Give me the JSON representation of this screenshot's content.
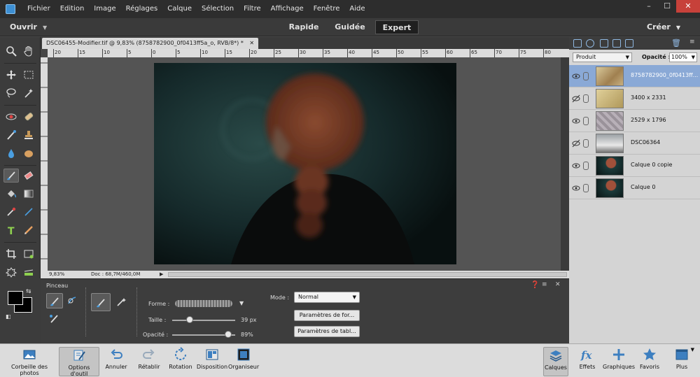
{
  "menubar": {
    "items": [
      "Fichier",
      "Edition",
      "Image",
      "Réglages",
      "Calque",
      "Sélection",
      "Filtre",
      "Affichage",
      "Fenêtre",
      "Aide"
    ],
    "window_controls": [
      "–",
      "☐",
      "✕"
    ]
  },
  "modebar": {
    "open_label": "Ouvrir",
    "tabs": [
      {
        "label": "Rapide"
      },
      {
        "label": "Guidée"
      },
      {
        "label": "Expert",
        "active": true
      }
    ],
    "create_label": "Créer"
  },
  "document": {
    "tab_title": "DSC06455-Modifier.tif @ 9,83% (8758782900_0f0413ff5a_o, RVB/8*) *",
    "close_symbol": "✕",
    "zoom": "9,83%",
    "doc_info": "Doc : 68,7M/460,0M",
    "ruler_ticks": [
      "20",
      "15",
      "10",
      "5",
      "0",
      "5",
      "10",
      "15",
      "20",
      "25",
      "30",
      "35",
      "40",
      "45",
      "50",
      "55",
      "60",
      "65",
      "70",
      "75",
      "80"
    ]
  },
  "options": {
    "tool_name": "Pinceau",
    "forme_label": "Forme :",
    "taille_label": "Taille :",
    "taille_value": "39 px",
    "taille_fraction": 0.28,
    "opacite_label": "Opacité :",
    "opacite_value": "89%",
    "opacite_fraction": 0.89,
    "mode_label": "Mode :",
    "mode_value": "Normal",
    "btn_form": "Paramètres de for...",
    "btn_tablet": "Paramètres de tabl..."
  },
  "layers_panel": {
    "blend_mode": "Produit",
    "opacity_label": "Opacité :",
    "opacity_value": "100%",
    "layers": [
      {
        "name": "8758782900_0f0413ff...",
        "selected": true,
        "visible": true
      },
      {
        "name": "3400 x 2331",
        "selected": false,
        "visible": false
      },
      {
        "name": "2529 x 1796",
        "selected": false,
        "visible": true
      },
      {
        "name": "DSC06364",
        "selected": false,
        "visible": false
      },
      {
        "name": "Calque 0 copie",
        "selected": false,
        "visible": true
      },
      {
        "name": "Calque 0",
        "selected": false,
        "visible": true
      }
    ]
  },
  "taskbar": {
    "left": [
      {
        "label": "Corbeille des photos",
        "icon": "photo-bin-icon"
      },
      {
        "label": "Options d'outil",
        "icon": "tool-options-icon",
        "active": true
      },
      {
        "label": "Annuler",
        "icon": "undo-icon"
      },
      {
        "label": "Rétablir",
        "icon": "redo-icon"
      },
      {
        "label": "Rotation",
        "icon": "rotate-icon"
      },
      {
        "label": "Disposition",
        "icon": "layout-icon"
      },
      {
        "label": "Organiseur",
        "icon": "organizer-icon"
      }
    ],
    "right": [
      {
        "label": "Calques",
        "icon": "layers-icon",
        "active": true
      },
      {
        "label": "Effets",
        "icon": "fx-icon"
      },
      {
        "label": "Graphiques",
        "icon": "plus-icon"
      },
      {
        "label": "Favoris",
        "icon": "star-icon"
      },
      {
        "label": "Plus",
        "icon": "more-icon"
      }
    ]
  },
  "colors": {
    "accent": "#8aa9d6",
    "foreground": "#000000",
    "background": "#000000"
  }
}
